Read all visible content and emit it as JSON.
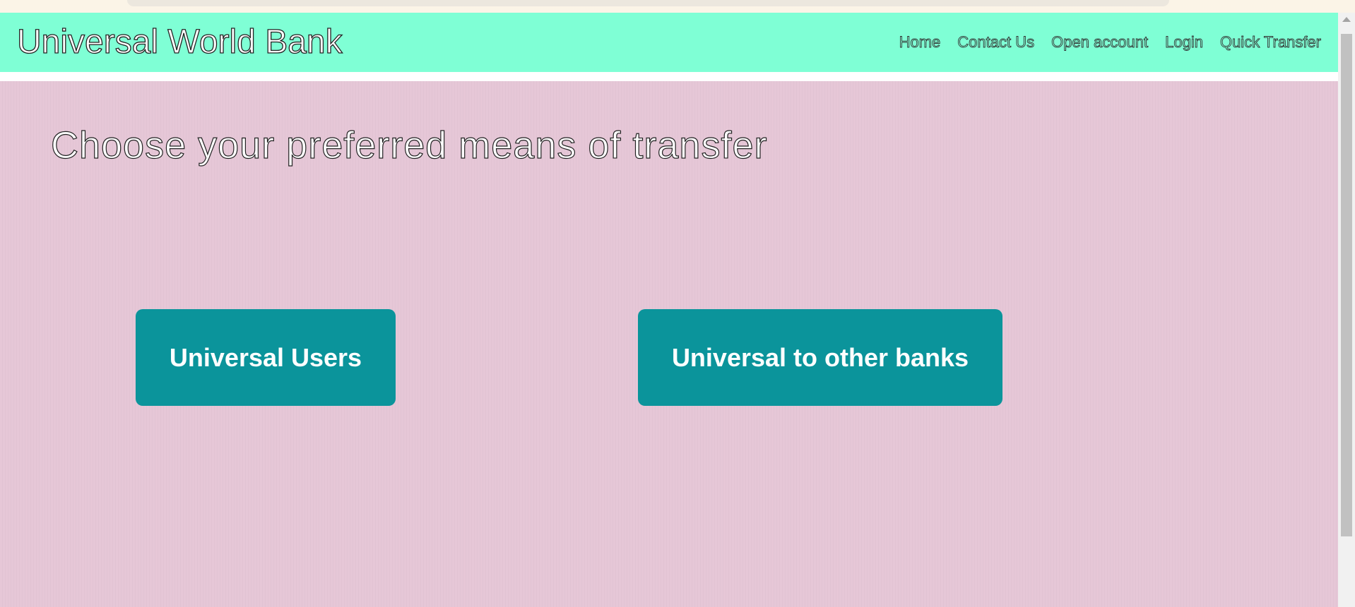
{
  "header": {
    "brand": "Universal World Bank",
    "nav": [
      "Home",
      "Contact Us",
      "Open account",
      "Login",
      "Quick Transfer"
    ]
  },
  "main": {
    "title": "Choose your preferred means of transfer",
    "options": [
      "Universal Users",
      "Universal to other banks"
    ]
  },
  "colors": {
    "navbar": "#7fffd5",
    "page_background": "#e5c6d6",
    "button": "#0b949b",
    "button_text": "#ffffff"
  }
}
